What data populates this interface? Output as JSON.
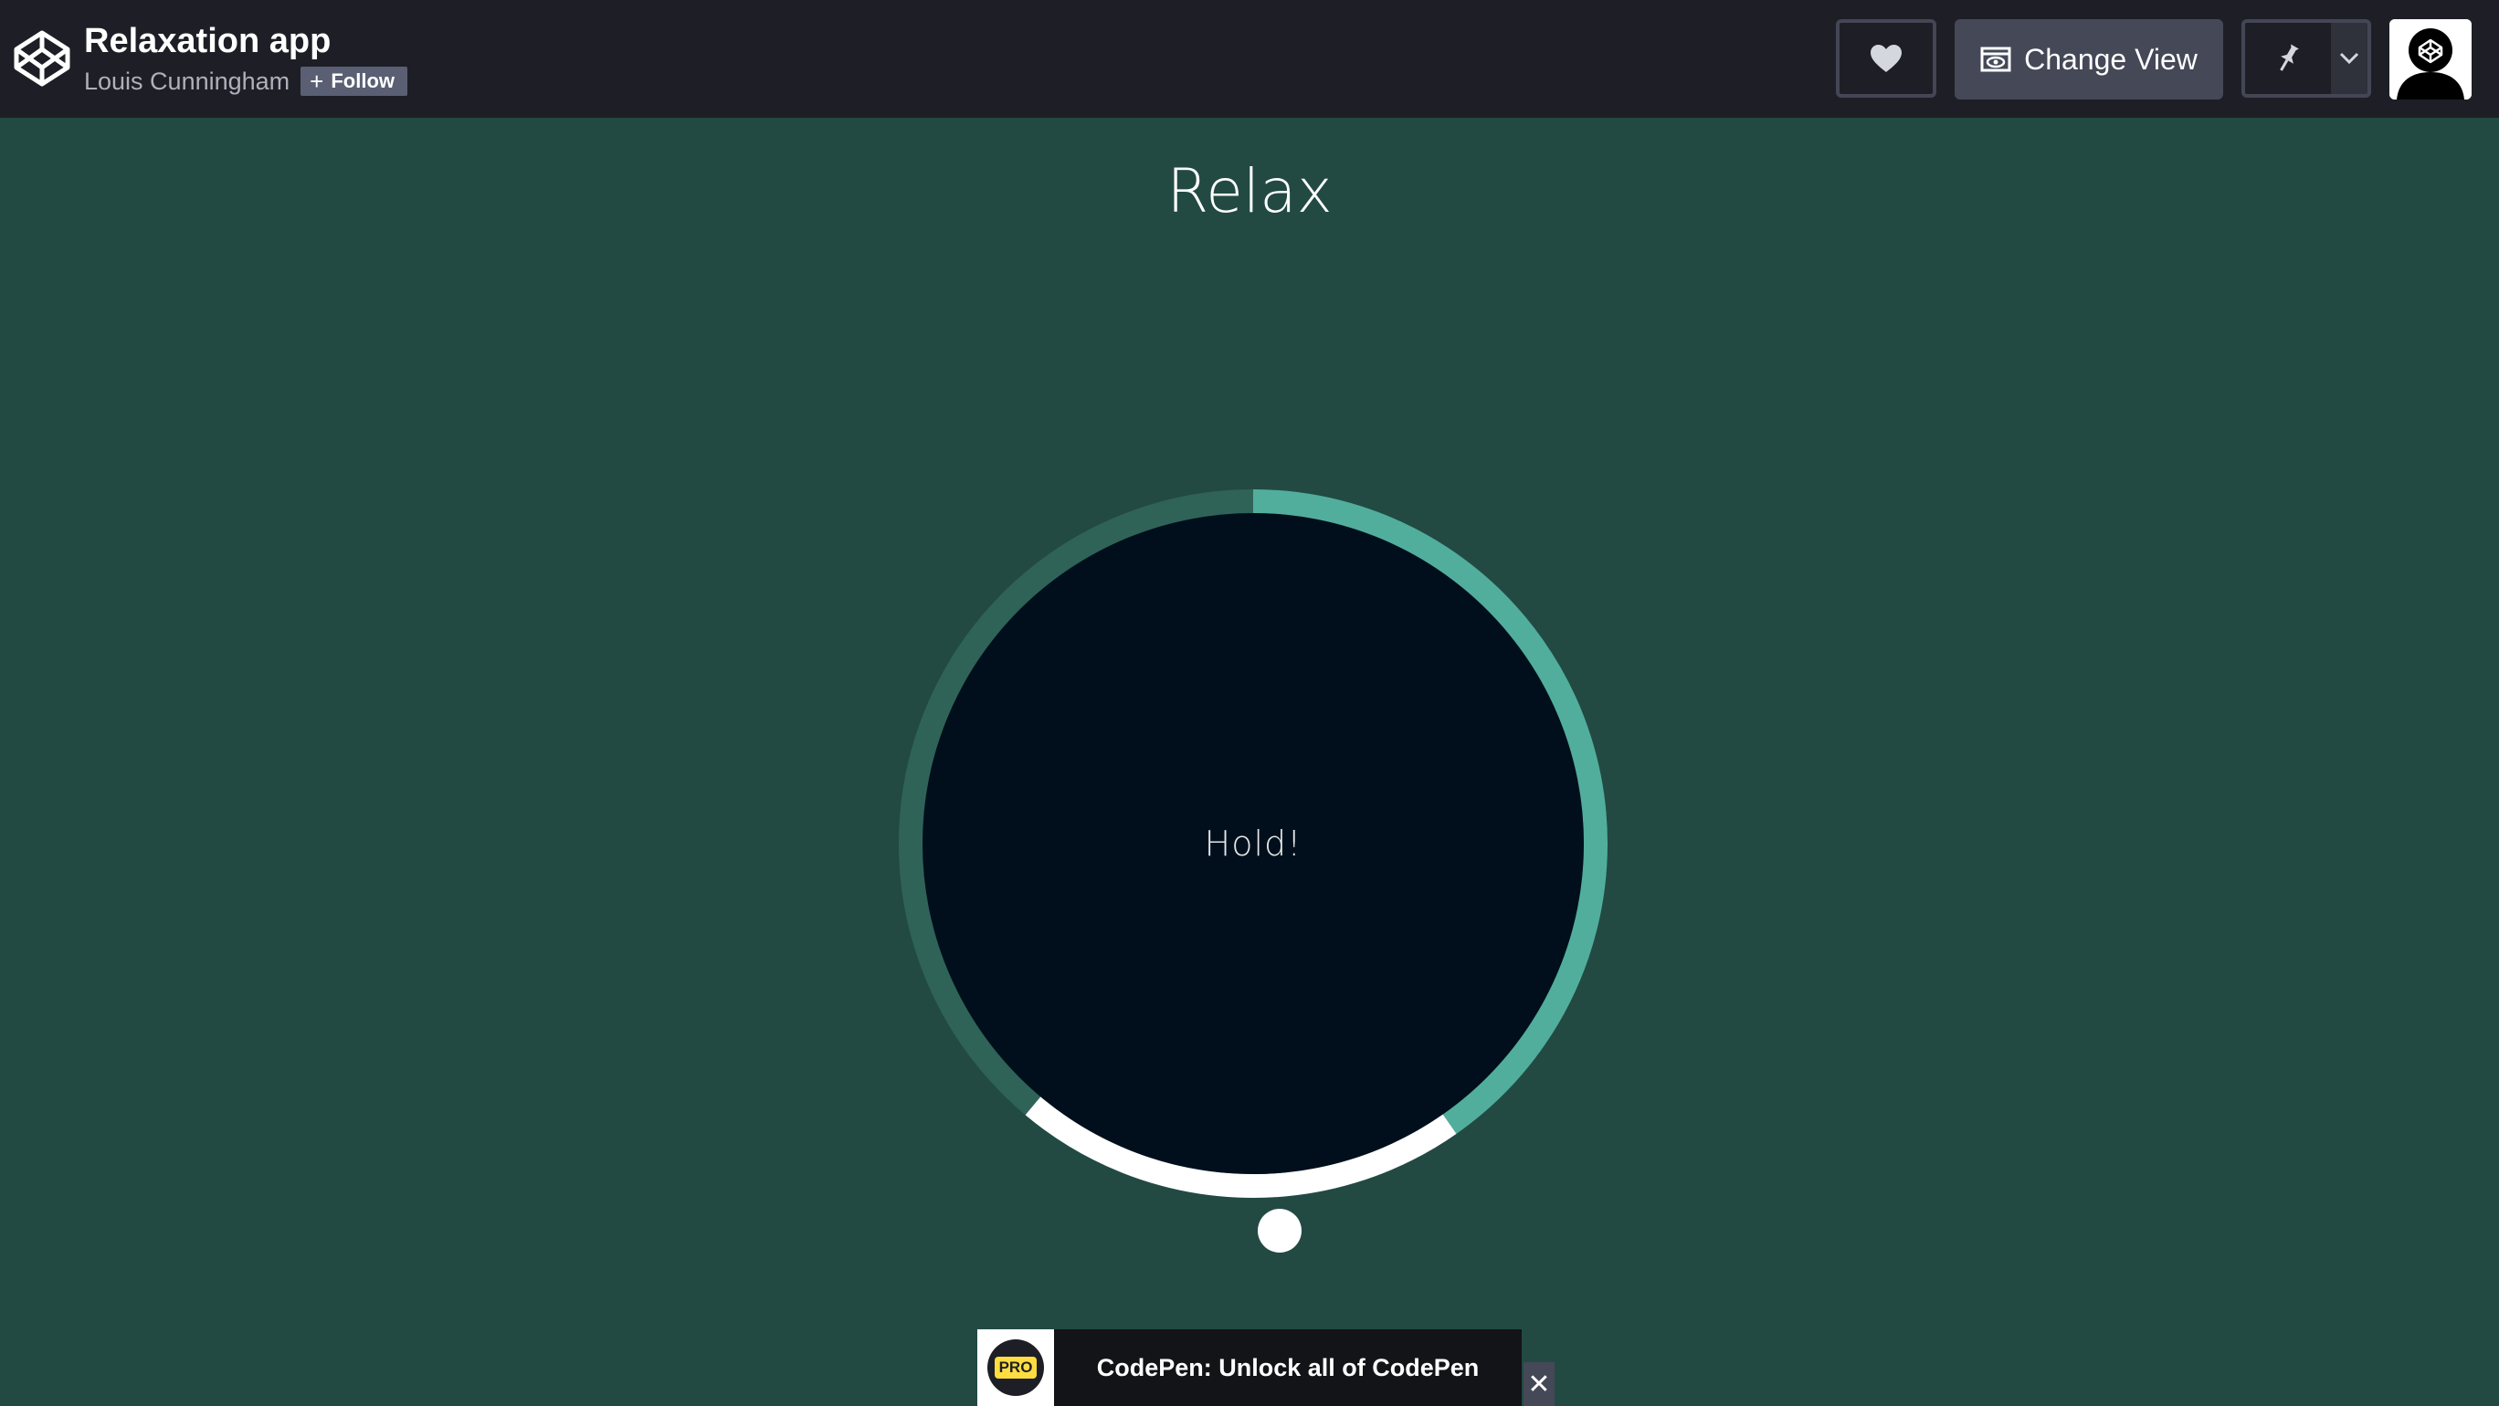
{
  "header": {
    "pen_title": "Relaxation app",
    "author": "Louis Cunningham",
    "follow_label": "Follow",
    "change_view_label": "Change View"
  },
  "icons": {
    "logo": "codepen-logo-icon",
    "heart": "heart-icon",
    "change_view": "window-eye-icon",
    "pin": "pin-icon",
    "chevron": "chevron-down-icon",
    "close": "close-icon",
    "avatar": "user-avatar-icon"
  },
  "main": {
    "title": "Relax",
    "status_text": "Hold!"
  },
  "breath_ring": {
    "segments": [
      {
        "name": "breathe-in",
        "from_deg": -180,
        "to_deg": 0,
        "color": "#2f6358"
      },
      {
        "name": "hold",
        "from_deg": 0,
        "to_deg": 145,
        "color": "#51ae9c"
      },
      {
        "name": "breathe-out",
        "from_deg": 145,
        "to_deg": 220,
        "color": "#ffffff"
      }
    ]
  },
  "promo": {
    "badge": "PRO",
    "text": "CodePen: Unlock all of CodePen",
    "close_symbol": "✕"
  },
  "colors": {
    "header_bg": "#1e1f26",
    "page_bg": "#224a43",
    "circle_fill": "#010f1c",
    "accent": "#51ae9c",
    "pro_yellow": "#ffdd40"
  }
}
